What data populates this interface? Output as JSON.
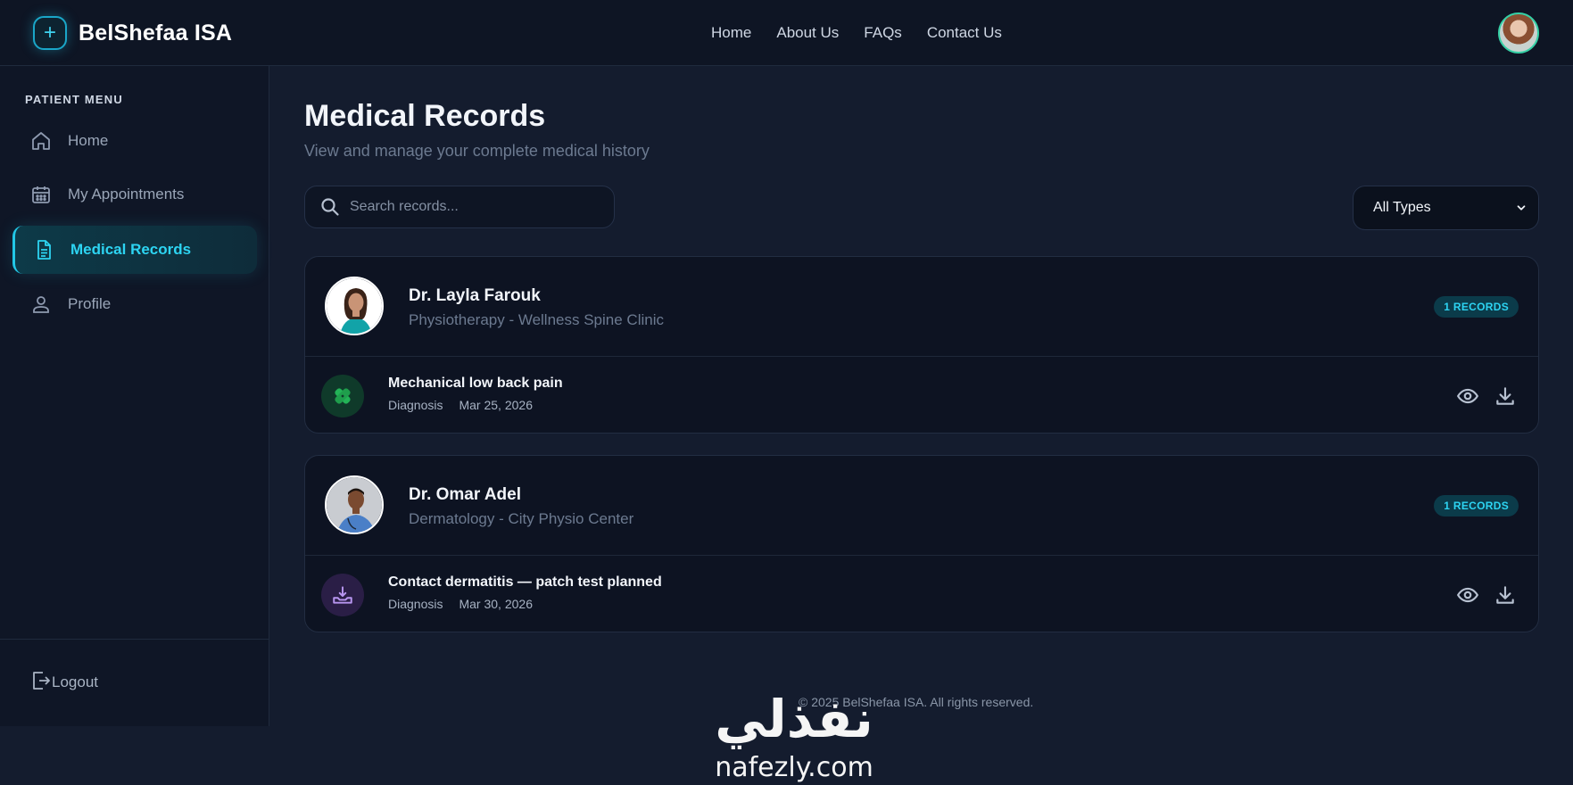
{
  "brand": {
    "name": "BelShefaa ISA",
    "logo_icon": "plus-icon",
    "accent": "#22c7e6"
  },
  "topnav": {
    "items": [
      "Home",
      "About Us",
      "FAQs",
      "Contact Us"
    ]
  },
  "sidebar": {
    "title": "PATIENT MENU",
    "items": [
      {
        "label": "Home",
        "icon": "home-icon"
      },
      {
        "label": "My Appointments",
        "icon": "calendar-icon"
      },
      {
        "label": "Medical Records",
        "icon": "document-icon",
        "active": true
      },
      {
        "label": "Profile",
        "icon": "user-icon"
      }
    ],
    "logout": "Logout"
  },
  "page": {
    "title": "Medical Records",
    "subtitle": "View and manage your complete medical history"
  },
  "search": {
    "placeholder": "Search records..."
  },
  "filter": {
    "selected": "All Types"
  },
  "doctors": [
    {
      "name": "Dr. Layla Farouk",
      "specialty": "Physiotherapy - Wellness Spine Clinic",
      "badge": "1 RECORDS",
      "record": {
        "title": "Mechanical low back pain",
        "type": "Diagnosis",
        "date": "Mar 25, 2026",
        "icon": "bandage-icon"
      }
    },
    {
      "name": "Dr. Omar Adel",
      "specialty": "Dermatology - City Physio Center",
      "badge": "1 RECORDS",
      "record": {
        "title": "Contact dermatitis — patch test planned",
        "type": "Diagnosis",
        "date": "Mar 30, 2026",
        "icon": "skin-icon"
      }
    }
  ],
  "footer": {
    "text": "© 2025 BelShefaa ISA. All rights reserved."
  },
  "watermark": {
    "arabic": "نفذلي",
    "latin": "nafezly.com"
  }
}
